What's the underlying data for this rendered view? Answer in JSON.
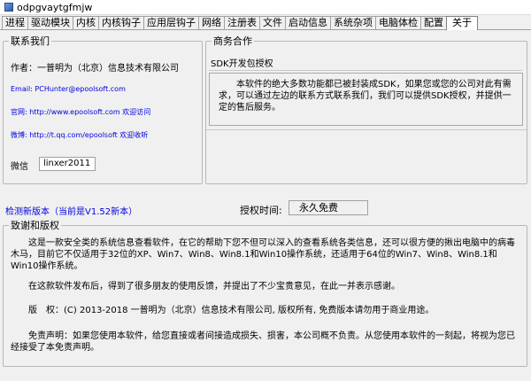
{
  "window": {
    "title": "odpgvaytgfmjw"
  },
  "tabs": [
    {
      "label": "进程"
    },
    {
      "label": "驱动模块"
    },
    {
      "label": "内核"
    },
    {
      "label": "内核钩子"
    },
    {
      "label": "应用层钩子"
    },
    {
      "label": "网络"
    },
    {
      "label": "注册表"
    },
    {
      "label": "文件"
    },
    {
      "label": "启动信息"
    },
    {
      "label": "系统杂项"
    },
    {
      "label": "电脑体检"
    },
    {
      "label": "配置"
    },
    {
      "label": "关于"
    }
  ],
  "active_tab": "关于",
  "contact": {
    "title": "联系我们",
    "author": "作者：一普明为（北京）信息技术有限公司",
    "email": "Email: PCHunter@epoolsoft.com",
    "website": "官网: http://www.epoolsoft.com 欢迎访问",
    "weibo": "微博: http://t.qq.com/epoolsoft 欢迎收听",
    "wechat_label": "微信",
    "wechat_value": "linxer2011"
  },
  "business": {
    "title": "商务合作",
    "sdk_title": "SDK开发包授权",
    "sdk_text": "本软件的绝大多数功能都已被封装成SDK，如果您或您的公司对此有需求，可以通过左边的联系方式联系我们，我们可以提供SDK授权，并提供一定的售后服务。"
  },
  "update": {
    "link": "检测新版本（当前是V1.52新本）"
  },
  "license": {
    "label": "授权时间:",
    "value": "永久免费"
  },
  "about": {
    "title": "致谢和版权",
    "p1": "这是一款安全类的系统信息查看软件，在它的帮助下您不但可以深入的查看系统各类信息，还可以很方便的揪出电脑中的病毒木马，目前它不仅适用于32位的XP、Win7、Win8、Win8.1和Win10操作系统，还适用于64位的Win7、Win8、Win8.1和Win10操作系统。",
    "p2": "在这款软件发布后，得到了很多朋友的使用反馈，并提出了不少宝贵意见，在此一并表示感谢。",
    "p3": "版　权：(C) 2013-2018 一普明为（北京）信息技术有限公司, 版权所有, 免费版本请勿用于商业用途。",
    "p4": "免责声明：如果您使用本软件，给您直接或者间接造成损失、损害，本公司概不负责。从您使用本软件的一刻起，将视为您已经接受了本免责声明。"
  }
}
